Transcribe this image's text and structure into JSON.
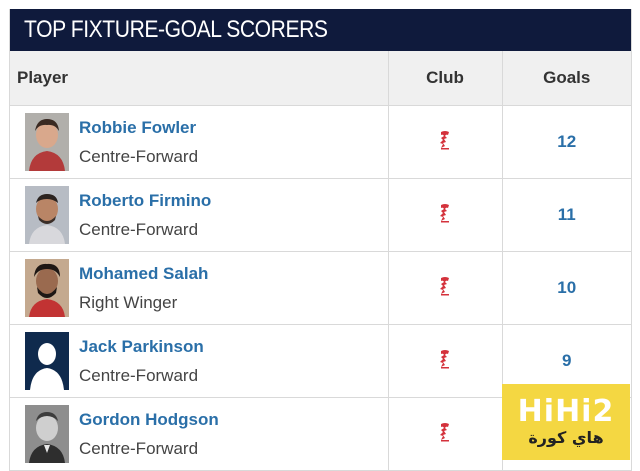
{
  "header": {
    "title": "TOP FIXTURE-GOAL SCORERS"
  },
  "table": {
    "columns": {
      "player": "Player",
      "club": "Club",
      "goals": "Goals"
    },
    "rows": [
      {
        "name": "Robbie Fowler",
        "position": "Centre-Forward",
        "club_icon": "liverpool-crest-icon",
        "goals": "12"
      },
      {
        "name": "Roberto Firmino",
        "position": "Centre-Forward",
        "club_icon": "liverpool-crest-icon",
        "goals": "11"
      },
      {
        "name": "Mohamed Salah",
        "position": "Right Winger",
        "club_icon": "liverpool-crest-icon",
        "goals": "10"
      },
      {
        "name": "Jack Parkinson",
        "position": "Centre-Forward",
        "club_icon": "liverpool-crest-icon",
        "goals": "9"
      },
      {
        "name": "Gordon Hodgson",
        "position": "Centre-Forward",
        "club_icon": "liverpool-crest-icon",
        "goals": ""
      }
    ]
  },
  "watermark": {
    "logo": "HiHi2",
    "subtitle": "هاي كورة"
  },
  "colors": {
    "title_bar": "#0f1a3c",
    "link": "#2a6fa8",
    "header_bg": "#f0f0f0",
    "club_red": "#d4323c",
    "watermark_bg": "#f4d742"
  }
}
